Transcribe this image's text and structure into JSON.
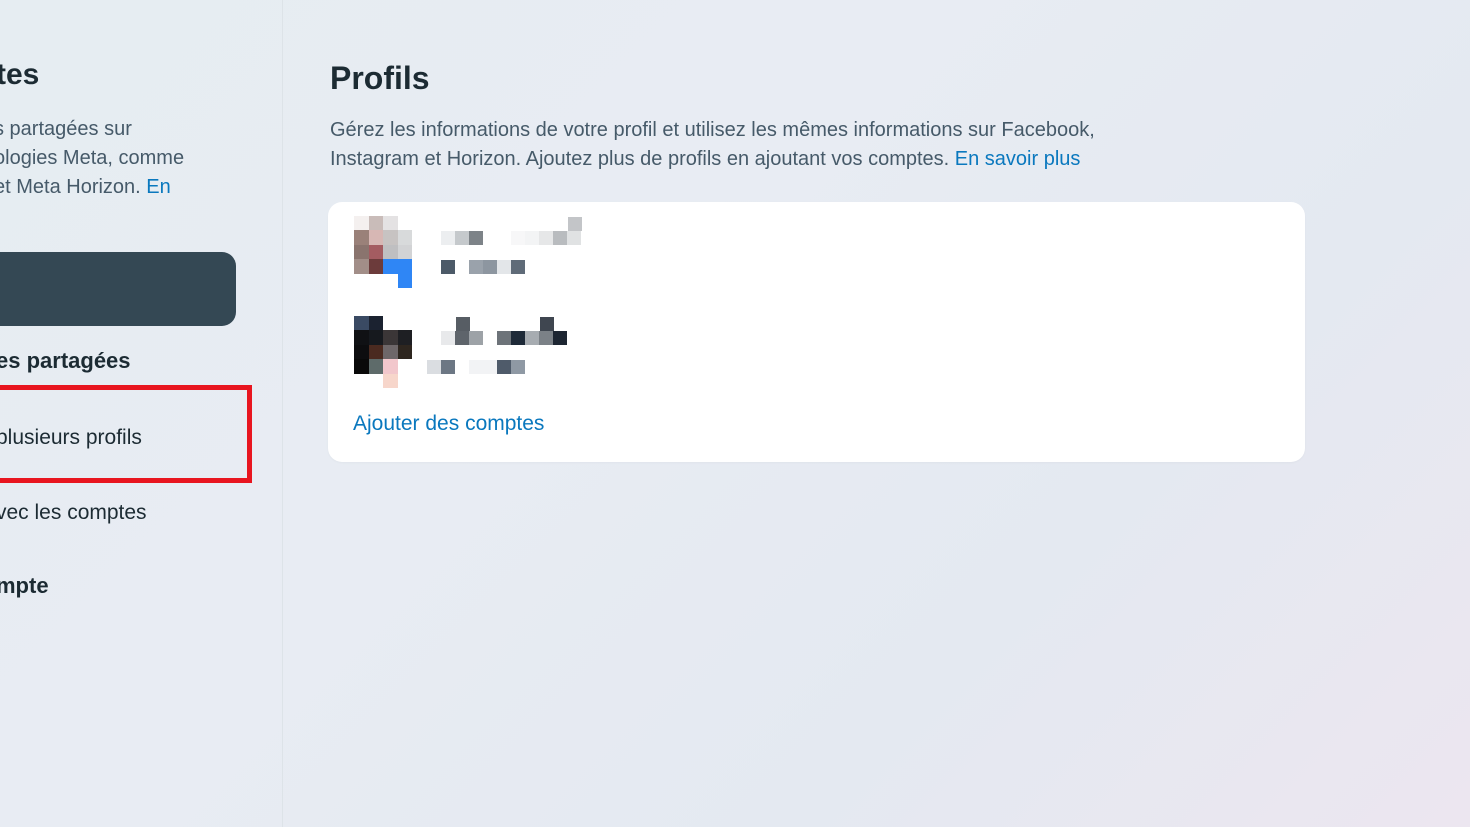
{
  "sidebar": {
    "title": "tes",
    "description_lines": [
      "s partagées sur",
      "ologies Meta, comme",
      "et Meta Horizon."
    ],
    "description_link": "En",
    "section_heading": "es partagées",
    "items": [
      {
        "label": "plusieurs profils"
      },
      {
        "label": "vec les comptes"
      },
      {
        "label": "mpte"
      }
    ]
  },
  "main": {
    "title": "Profils",
    "description_line1": "Gérez les informations de votre profil et utilisez les mêmes informations sur Facebook,",
    "description_line2": "Instagram et Horizon. Ajoutez plus de profils en ajoutant vos comptes.",
    "learn_more": "En savoir plus",
    "add_accounts": "Ajouter des comptes"
  },
  "colors": {
    "accent": "#0a78be",
    "highlight": "#e8151f",
    "dark_button": "#344854"
  }
}
